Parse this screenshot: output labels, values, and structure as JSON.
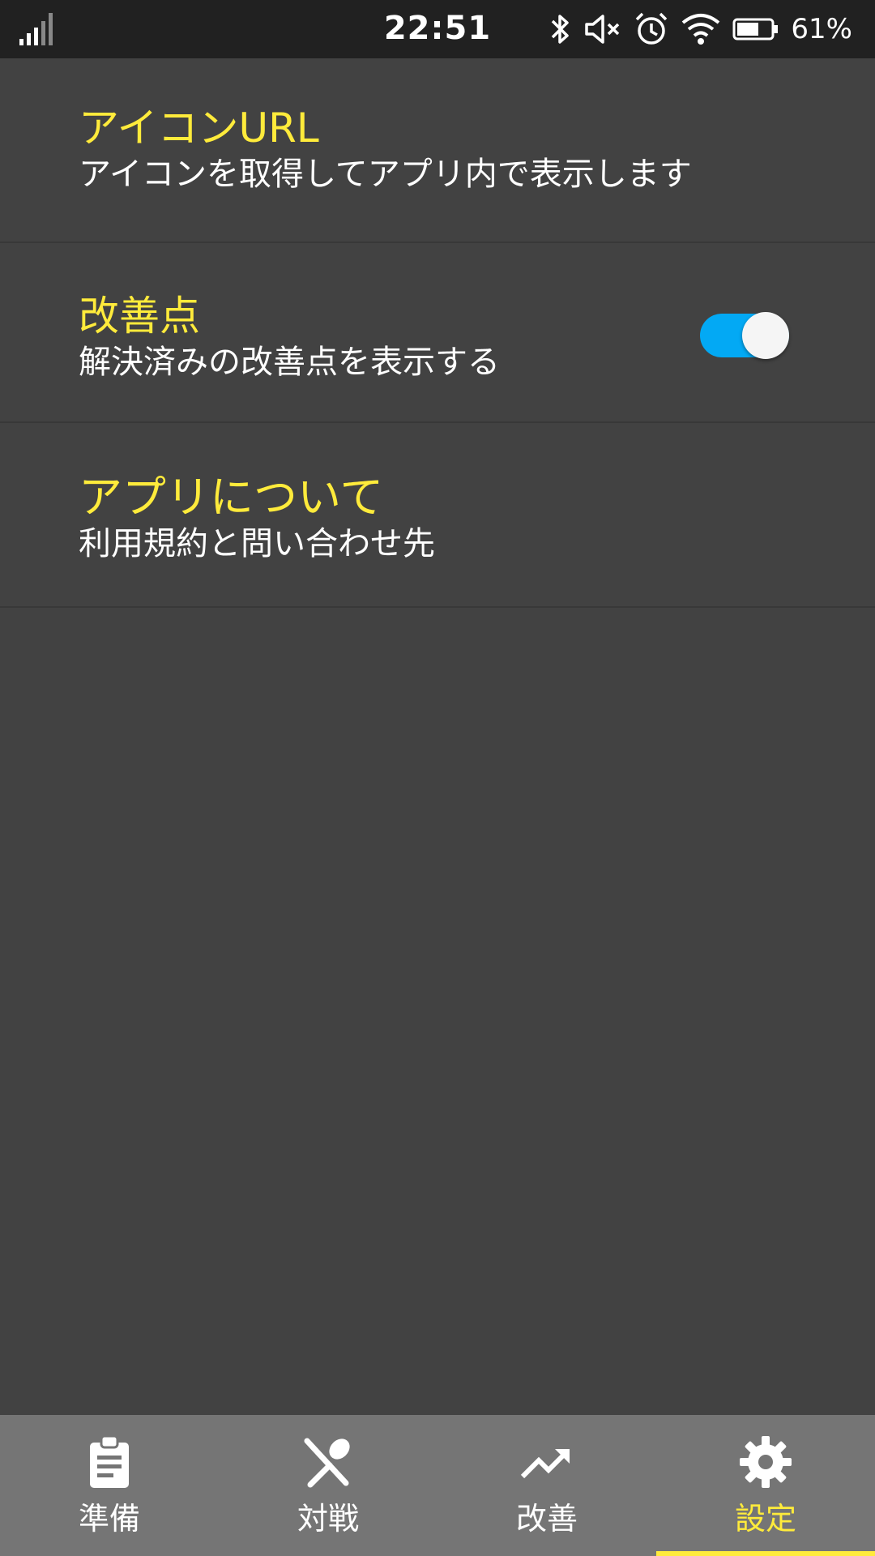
{
  "status_bar": {
    "time": "22:51",
    "battery_percent": "61%",
    "icons": [
      "signal-icon",
      "bluetooth-icon",
      "mute-icon",
      "alarm-icon",
      "wifi-icon",
      "battery-icon"
    ]
  },
  "settings": [
    {
      "title": "アイコンURL",
      "subtitle": "アイコンを取得してアプリ内で表示します"
    },
    {
      "title": "改善点",
      "subtitle": "解決済みの改善点を表示する",
      "toggle_on": true
    },
    {
      "title": "アプリについて",
      "subtitle": "利用規約と問い合わせ先"
    }
  ],
  "bottom_nav": {
    "items": [
      {
        "label": "準備",
        "icon": "clipboard-icon"
      },
      {
        "label": "対戦",
        "icon": "utensils-crossed-icon"
      },
      {
        "label": "改善",
        "icon": "trending-up-icon"
      },
      {
        "label": "設定",
        "icon": "gear-icon"
      }
    ],
    "active_index": 3
  },
  "colors": {
    "accent_yellow": "#ffeb3b",
    "toggle_blue": "#03a9f4",
    "background": "#424242",
    "nav_background": "#757575",
    "status_bar": "#212121"
  }
}
